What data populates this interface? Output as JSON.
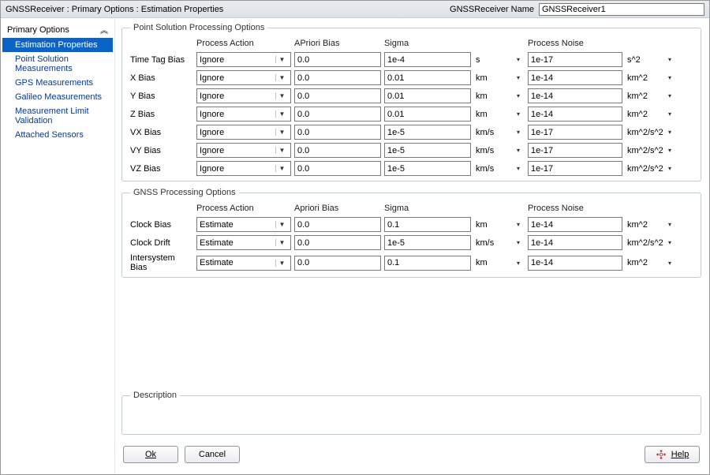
{
  "header": {
    "breadcrumb": "GNSSReceiver : Primary Options : Estimation Properties",
    "name_label": "GNSSReceiver Name",
    "name_value": "GNSSReceiver1"
  },
  "sidebar": {
    "heading": "Primary Options",
    "items": [
      {
        "label": "Estimation Properties",
        "selected": true
      },
      {
        "label": "Point Solution Measurements"
      },
      {
        "label": "GPS Measurements"
      },
      {
        "label": "Galileo Measurements"
      },
      {
        "label": "Measurement Limit Validation"
      },
      {
        "label": "Attached Sensors"
      }
    ]
  },
  "pspo": {
    "legend": "Point Solution Processing Options",
    "cols": {
      "action": "Process Action",
      "aprior": "APriori Bias",
      "sigma": "Sigma",
      "noise": "Process Noise"
    },
    "rows": [
      {
        "label": "Time Tag Bias",
        "action": "Ignore",
        "aprior": "0.0",
        "sigma": "1e-4",
        "unit1": "s",
        "noise": "1e-17",
        "unit2": "s^2"
      },
      {
        "label": "X Bias",
        "action": "Ignore",
        "aprior": "0.0",
        "sigma": "0.01",
        "unit1": "km",
        "noise": "1e-14",
        "unit2": "km^2"
      },
      {
        "label": "Y Bias",
        "action": "Ignore",
        "aprior": "0.0",
        "sigma": "0.01",
        "unit1": "km",
        "noise": "1e-14",
        "unit2": "km^2"
      },
      {
        "label": "Z Bias",
        "action": "Ignore",
        "aprior": "0.0",
        "sigma": "0.01",
        "unit1": "km",
        "noise": "1e-14",
        "unit2": "km^2"
      },
      {
        "label": "VX Bias",
        "action": "Ignore",
        "aprior": "0.0",
        "sigma": "1e-5",
        "unit1": "km/s",
        "noise": "1e-17",
        "unit2": "km^2/s^2"
      },
      {
        "label": "VY Bias",
        "action": "Ignore",
        "aprior": "0.0",
        "sigma": "1e-5",
        "unit1": "km/s",
        "noise": "1e-17",
        "unit2": "km^2/s^2"
      },
      {
        "label": "VZ Bias",
        "action": "Ignore",
        "aprior": "0.0",
        "sigma": "1e-5",
        "unit1": "km/s",
        "noise": "1e-17",
        "unit2": "km^2/s^2"
      }
    ]
  },
  "gnss": {
    "legend": "GNSS Processing Options",
    "cols": {
      "action": "Process Action",
      "aprior": "Apriori Bias",
      "sigma": "Sigma",
      "noise": "Process Noise"
    },
    "rows": [
      {
        "label": "Clock Bias",
        "action": "Estimate",
        "aprior": "0.0",
        "sigma": "0.1",
        "unit1": "km",
        "noise": "1e-14",
        "unit2": "km^2"
      },
      {
        "label": "Clock Drift",
        "action": "Estimate",
        "aprior": "0.0",
        "sigma": "1e-5",
        "unit1": "km/s",
        "noise": "1e-14",
        "unit2": "km^2/s^2"
      },
      {
        "label": "Intersystem Bias",
        "action": "Estimate",
        "aprior": "0.0",
        "sigma": "0.1",
        "unit1": "km",
        "noise": "1e-14",
        "unit2": "km^2"
      }
    ]
  },
  "desc": {
    "legend": "Description"
  },
  "footer": {
    "ok": "Ok",
    "cancel": "Cancel",
    "help": "Help"
  }
}
